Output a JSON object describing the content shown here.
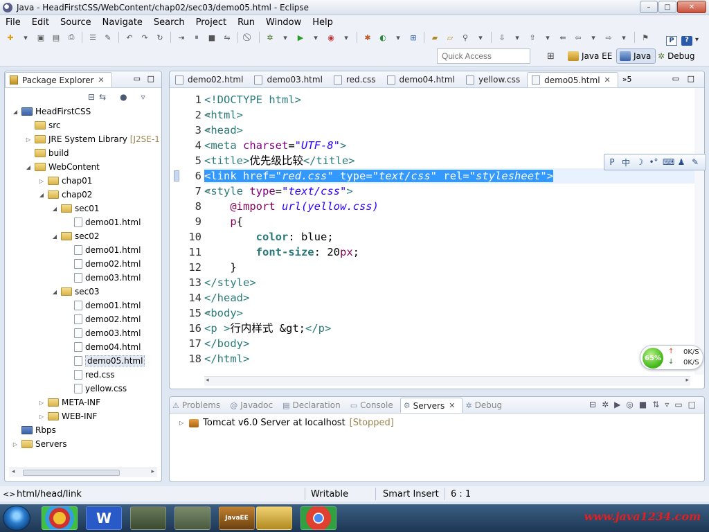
{
  "window": {
    "title": "Java - HeadFirstCSS/WebContent/chap02/sec03/demo05.html - Eclipse",
    "minimize": "–",
    "maximize": "□",
    "close": "✕"
  },
  "menu": [
    "File",
    "Edit",
    "Source",
    "Navigate",
    "Search",
    "Project",
    "Run",
    "Window",
    "Help"
  ],
  "quick_access": {
    "placeholder": "Quick Access"
  },
  "perspectives": [
    {
      "label": "Java EE",
      "active": false
    },
    {
      "label": "Java",
      "active": true
    },
    {
      "label": "Debug",
      "active": false
    }
  ],
  "package_explorer": {
    "tab_label": "Package Explorer",
    "tree": [
      {
        "label": "HeadFirstCSS",
        "level": 0,
        "arrow": "◢",
        "icon": "project-icon"
      },
      {
        "label": "src",
        "level": 1,
        "arrow": "",
        "icon": "package-folder-icon"
      },
      {
        "label": "JRE System Library",
        "suffix": "[J2SE-1",
        "level": 1,
        "arrow": "▷",
        "icon": "library-icon"
      },
      {
        "label": "build",
        "level": 1,
        "arrow": "",
        "icon": "folder-icon"
      },
      {
        "label": "WebContent",
        "level": 1,
        "arrow": "◢",
        "icon": "folder-icon"
      },
      {
        "label": "chap01",
        "level": 2,
        "arrow": "▷",
        "icon": "folder-icon"
      },
      {
        "label": "chap02",
        "level": 2,
        "arrow": "◢",
        "icon": "folder-icon"
      },
      {
        "label": "sec01",
        "level": 3,
        "arrow": "◢",
        "icon": "folder-icon"
      },
      {
        "label": "demo01.html",
        "level": 4,
        "arrow": "",
        "icon": "html-file-icon"
      },
      {
        "label": "sec02",
        "level": 3,
        "arrow": "◢",
        "icon": "folder-icon"
      },
      {
        "label": "demo01.html",
        "level": 4,
        "arrow": "",
        "icon": "html-file-icon"
      },
      {
        "label": "demo02.html",
        "level": 4,
        "arrow": "",
        "icon": "html-file-icon"
      },
      {
        "label": "demo03.html",
        "level": 4,
        "arrow": "",
        "icon": "html-file-icon"
      },
      {
        "label": "sec03",
        "level": 3,
        "arrow": "◢",
        "icon": "folder-icon"
      },
      {
        "label": "demo01.html",
        "level": 4,
        "arrow": "",
        "icon": "html-file-icon"
      },
      {
        "label": "demo02.html",
        "level": 4,
        "arrow": "",
        "icon": "html-file-icon"
      },
      {
        "label": "demo03.html",
        "level": 4,
        "arrow": "",
        "icon": "html-file-icon"
      },
      {
        "label": "demo04.html",
        "level": 4,
        "arrow": "",
        "icon": "html-file-icon"
      },
      {
        "label": "demo05.html",
        "level": 4,
        "arrow": "",
        "icon": "html-file-icon",
        "selected": true
      },
      {
        "label": "red.css",
        "level": 4,
        "arrow": "",
        "icon": "css-file-icon"
      },
      {
        "label": "yellow.css",
        "level": 4,
        "arrow": "",
        "icon": "css-file-icon"
      },
      {
        "label": "META-INF",
        "level": 2,
        "arrow": "▷",
        "icon": "folder-icon"
      },
      {
        "label": "WEB-INF",
        "level": 2,
        "arrow": "▷",
        "icon": "folder-icon"
      },
      {
        "label": "Rbps",
        "level": 0,
        "arrow": "",
        "icon": "project-icon"
      },
      {
        "label": "Servers",
        "level": 0,
        "arrow": "▷",
        "icon": "folder-icon"
      }
    ]
  },
  "editor": {
    "tabs": [
      {
        "label": "demo02.html",
        "active": false
      },
      {
        "label": "demo03.html",
        "active": false
      },
      {
        "label": "red.css",
        "active": false
      },
      {
        "label": "demo04.html",
        "active": false
      },
      {
        "label": "yellow.css",
        "active": false
      },
      {
        "label": "demo05.html",
        "active": true
      }
    ],
    "overflow_label": "»5",
    "lines": [
      {
        "n": "1",
        "fold": "",
        "segs": [
          [
            "tag",
            "<!DOCTYPE html>"
          ]
        ]
      },
      {
        "n": "2",
        "fold": "⊖",
        "segs": [
          [
            "tag",
            "<html>"
          ]
        ]
      },
      {
        "n": "3",
        "fold": "⊖",
        "segs": [
          [
            "tag",
            "<head>"
          ]
        ]
      },
      {
        "n": "4",
        "fold": "",
        "segs": [
          [
            "tag",
            "<meta "
          ],
          [
            "attr",
            "charset"
          ],
          [
            "txt",
            "="
          ],
          [
            "val",
            "\"UTF-8\""
          ],
          [
            "tag",
            ">"
          ]
        ]
      },
      {
        "n": "5",
        "fold": "",
        "segs": [
          [
            "tag",
            "<title>"
          ],
          [
            "txt",
            "优先级比较"
          ],
          [
            "tag",
            "</title>"
          ]
        ]
      },
      {
        "n": "6",
        "fold": "",
        "selected": true,
        "segs": [
          [
            "tag",
            "<link "
          ],
          [
            "attr",
            "href"
          ],
          [
            "txt",
            "="
          ],
          [
            "val",
            "\"red.css\""
          ],
          [
            "txt",
            " "
          ],
          [
            "attr",
            "type"
          ],
          [
            "txt",
            "="
          ],
          [
            "val",
            "\"text/css\""
          ],
          [
            "txt",
            " "
          ],
          [
            "attr",
            "rel"
          ],
          [
            "txt",
            "="
          ],
          [
            "val",
            "\"stylesheet\""
          ],
          [
            "tag",
            ">"
          ]
        ]
      },
      {
        "n": "7",
        "fold": "⊖",
        "segs": [
          [
            "tag",
            "<style "
          ],
          [
            "attr",
            "type"
          ],
          [
            "txt",
            "="
          ],
          [
            "val",
            "\"text/css\""
          ],
          [
            "tag",
            ">"
          ]
        ]
      },
      {
        "n": "8",
        "fold": "",
        "segs": [
          [
            "txt",
            "    "
          ],
          [
            "kw",
            "@import "
          ],
          [
            "val",
            "url(yellow.css)"
          ]
        ]
      },
      {
        "n": "9",
        "fold": "",
        "segs": [
          [
            "txt",
            "    "
          ],
          [
            "kw",
            "p"
          ],
          [
            "txt",
            "{"
          ]
        ]
      },
      {
        "n": "10",
        "fold": "",
        "segs": [
          [
            "txt",
            "        "
          ],
          [
            "prop",
            "color"
          ],
          [
            "txt",
            ": blue;"
          ]
        ]
      },
      {
        "n": "11",
        "fold": "",
        "segs": [
          [
            "txt",
            "        "
          ],
          [
            "prop",
            "font-size"
          ],
          [
            "txt",
            ": 20"
          ],
          [
            "kw",
            "px"
          ],
          [
            "txt",
            ";"
          ]
        ]
      },
      {
        "n": "12",
        "fold": "",
        "segs": [
          [
            "txt",
            "    }"
          ]
        ]
      },
      {
        "n": "13",
        "fold": "",
        "segs": [
          [
            "tag",
            "</style>"
          ]
        ]
      },
      {
        "n": "14",
        "fold": "",
        "segs": [
          [
            "tag",
            "</head>"
          ]
        ]
      },
      {
        "n": "15",
        "fold": "⊖",
        "segs": [
          [
            "tag",
            "<body>"
          ]
        ]
      },
      {
        "n": "16",
        "fold": "",
        "segs": [
          [
            "tag",
            "<p "
          ],
          [
            "tag",
            ">"
          ],
          [
            "txt",
            "行内样式 &gt;"
          ],
          [
            "tag",
            "</p>"
          ]
        ]
      },
      {
        "n": "17",
        "fold": "",
        "segs": [
          [
            "tag",
            "</body>"
          ]
        ]
      },
      {
        "n": "18",
        "fold": "",
        "segs": [
          [
            "tag",
            "</html>"
          ]
        ]
      }
    ]
  },
  "bottom_panel": {
    "tabs": [
      {
        "label": "Problems",
        "active": false
      },
      {
        "label": "Javadoc",
        "active": false
      },
      {
        "label": "Declaration",
        "active": false
      },
      {
        "label": "Console",
        "active": false
      },
      {
        "label": "Servers",
        "active": true
      },
      {
        "label": "Debug",
        "active": false
      }
    ],
    "server": {
      "name": "Tomcat v6.0 Server at localhost",
      "state": "[Stopped]"
    }
  },
  "status": {
    "path": "html/head/link",
    "writable": "Writable",
    "insert_mode": "Smart Insert",
    "position": "6 : 1"
  },
  "net_widget": {
    "percent": "65%",
    "up": "0K/S",
    "down": "0K/S"
  },
  "ime": [
    "P",
    "中",
    "☽",
    "•°",
    "⌨",
    "♟",
    "✎"
  ],
  "taskbar": {
    "apps": [
      "W",
      "",
      "",
      "JavaEE",
      "",
      ""
    ],
    "watermark": "www.java1234.com"
  }
}
